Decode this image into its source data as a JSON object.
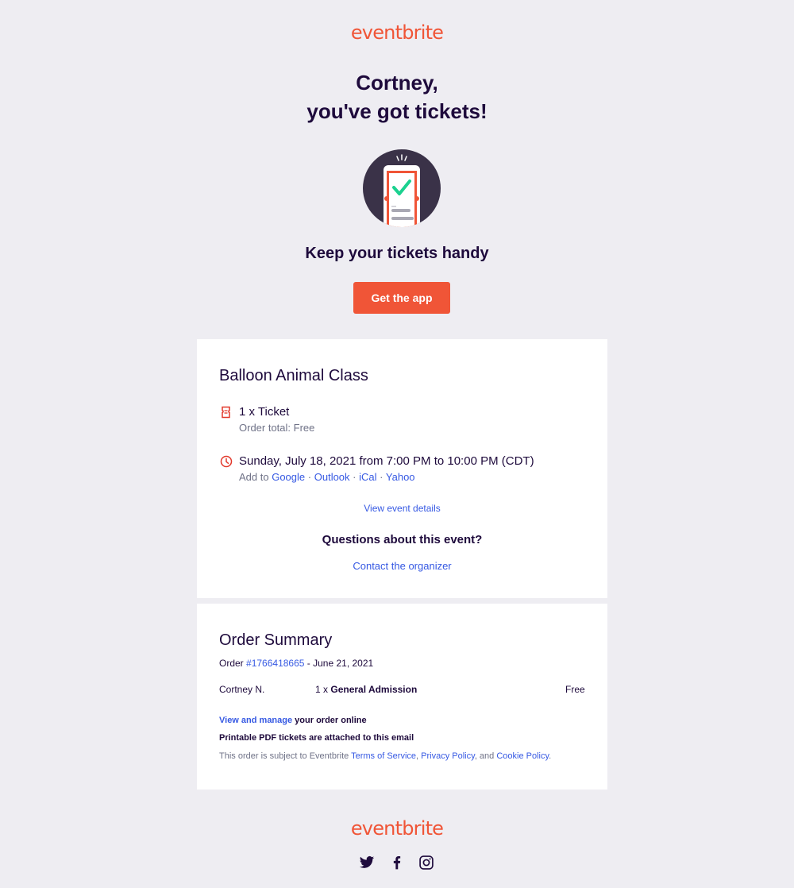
{
  "brand": {
    "logo_text": "eventbrite",
    "accent_color": "#f05537",
    "text_color": "#1e0a3c",
    "link_color": "#3659e3"
  },
  "header": {
    "greeting_line1": "Cortney,",
    "greeting_line2": "you've got tickets!",
    "hero_icon": "phone-ticket-check-icon",
    "subheading": "Keep your tickets handy",
    "app_button_label": "Get the app"
  },
  "event": {
    "title": "Balloon Animal Class",
    "ticket_line": "1 x Ticket",
    "order_total": "Order total: Free",
    "datetime": "Sunday, July 18, 2021 from 7:00 PM to 10:00 PM (CDT)",
    "add_to_label": "Add to",
    "calendars": [
      "Google",
      "Outlook",
      "iCal",
      "Yahoo"
    ],
    "separator": "·",
    "view_details_label": "View event details",
    "questions_heading": "Questions about this event?",
    "contact_label": "Contact the organizer"
  },
  "order_summary": {
    "title": "Order Summary",
    "order_prefix": "Order",
    "order_number": "#1766418665",
    "order_date": "- June 21, 2021",
    "line_items": [
      {
        "attendee": "Cortney N.",
        "quantity": "1 x",
        "ticket_type": "General Admission",
        "price": "Free"
      }
    ],
    "manage_link": "View and manage",
    "manage_suffix": "your order online",
    "pdf_note": "Printable PDF tickets are attached to this email",
    "legal_prefix": "This order is subject to Eventbrite",
    "terms_label": "Terms of Service",
    "privacy_label": "Privacy Policy",
    "legal_and": ", and",
    "cookie_label": "Cookie Policy",
    "legal_comma": ",",
    "legal_end": "."
  },
  "footer": {
    "logo_text": "eventbrite",
    "social": [
      "twitter-icon",
      "facebook-icon",
      "instagram-icon"
    ]
  }
}
